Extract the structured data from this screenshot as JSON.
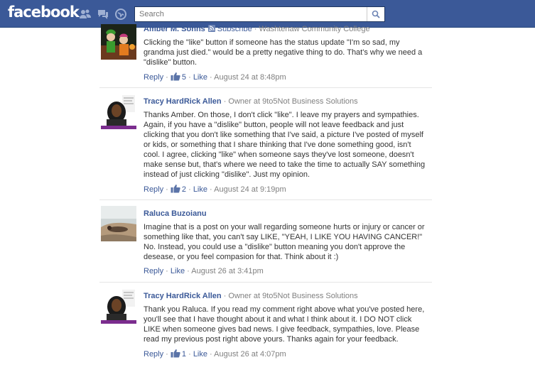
{
  "header": {
    "logo": "facebook",
    "search_placeholder": "Search",
    "icons": [
      "friend-requests-icon",
      "messages-icon",
      "notifications-icon",
      "magnifier-icon"
    ]
  },
  "colors": {
    "brand": "#3b5998",
    "link": "#3b5998",
    "meta": "#808080",
    "text": "#333333"
  },
  "comments": [
    {
      "author": "Amber M. Sohns",
      "subscribe": "Subscribe",
      "affiliation": "Washtenaw Community College",
      "text": "Clicking the \"like\" button if someone has the status update \"I'm so sad, my grandma just died.\" would be a pretty negative thing to do. That's why we need a \"dislike\" button.",
      "reply": "Reply",
      "likes": "5",
      "like": "Like",
      "time": "August 24 at 8:48pm"
    },
    {
      "author": "Tracy HardRick Allen",
      "affiliation": "Owner at 9to5Not Business Solutions",
      "text": "Thanks Amber. On those, I don't click \"like\". I leave my prayers and sympathies. Again, if you have a \"dislike\" button, people will not leave feedback and just clicking that you don't like something that I've said, a picture I've posted of myself or kids, or something that I share thinking that I've done something good, isn't cool. I agree, clicking \"like\" when someone says they've lost someone, doesn't make sense but, that's where we need to take the time to actually SAY something instead of just clicking \"dislike\". Just my opinion.",
      "reply": "Reply",
      "likes": "2",
      "like": "Like",
      "time": "August 24 at 9:19pm"
    },
    {
      "author": "Raluca Buzoianu",
      "text": "Imagine that is a post on your wall regarding someone hurts or injury or cancer or something like that, you can't say LIKE, \"YEAH, I LIKE YOU HAVING CANCER!\" No. Instead, you could use a \"dislike\" button meaning you don't approve the desease, or you feel compasion for that. Think about it :)",
      "reply": "Reply",
      "like": "Like",
      "time": "August 26 at 3:41pm"
    },
    {
      "author": "Tracy HardRick Allen",
      "affiliation": "Owner at 9to5Not Business Solutions",
      "text": "Thank you Raluca. If you read my comment right above what you've posted here, you'll see that I have thought about it and what I think about it. I DO NOT click LIKE when someone gives bad news. I give feedback, sympathies, love. Please read my previous post right above yours. Thanks again for your feedback.",
      "reply": "Reply",
      "likes": "1",
      "like": "Like",
      "time": "August 26 at 4:07pm"
    }
  ]
}
